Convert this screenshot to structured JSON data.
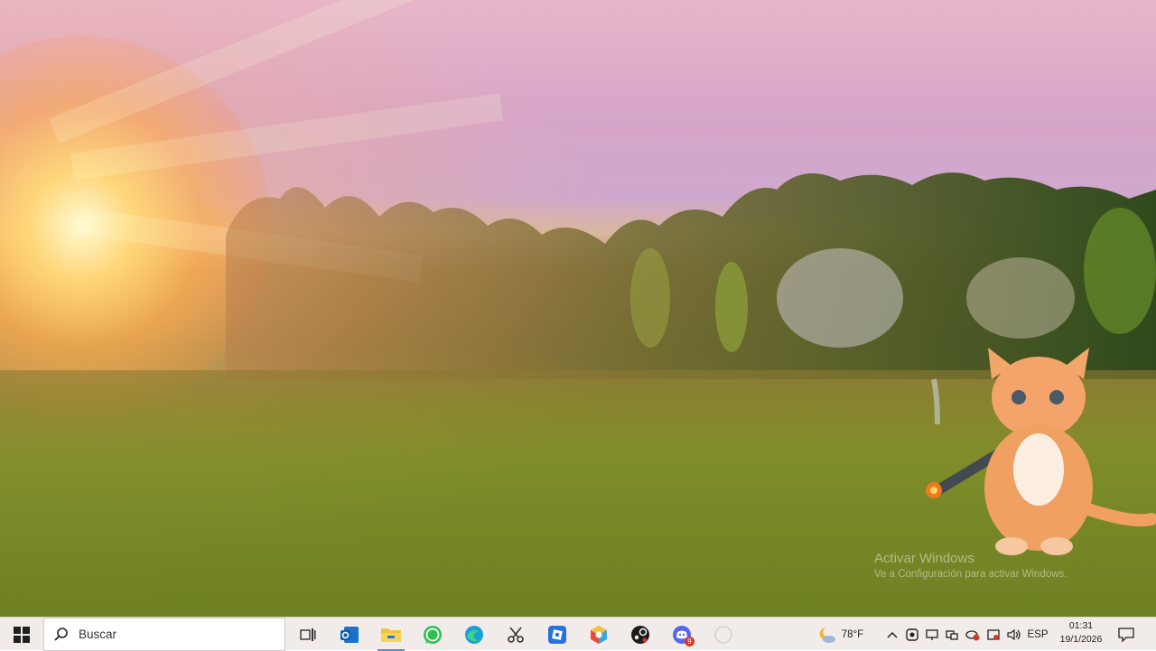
{
  "watermark": {
    "title": "Activar Windows",
    "subtitle": "Ve a Configuración para activar Windows."
  },
  "taskbar": {
    "search_placeholder": "Buscar",
    "apps": [
      {
        "name": "Task View",
        "icon": "task-view-icon"
      },
      {
        "name": "Outlook",
        "icon": "outlook-icon"
      },
      {
        "name": "File Explorer",
        "icon": "folder-icon",
        "active": true
      },
      {
        "name": "WhatsApp",
        "icon": "whatsapp-icon"
      },
      {
        "name": "Microsoft Edge",
        "icon": "edge-icon"
      },
      {
        "name": "Snipping Tool",
        "icon": "scissors-icon"
      },
      {
        "name": "Roblox",
        "icon": "roblox-icon"
      },
      {
        "name": "Game Launcher",
        "icon": "cube-icon"
      },
      {
        "name": "Steam",
        "icon": "steam-icon"
      },
      {
        "name": "Discord",
        "icon": "discord-icon",
        "badge": "9"
      }
    ],
    "weather": {
      "temp": "78°F",
      "icon": "moon-cloud-icon"
    },
    "language": "ESP",
    "clock": {
      "time": "01:31",
      "date": "19/1/2026"
    }
  },
  "colors": {
    "taskbar_bg": "#f1ecea",
    "accent": "#5b8dc9",
    "notification": "#d6362b"
  }
}
